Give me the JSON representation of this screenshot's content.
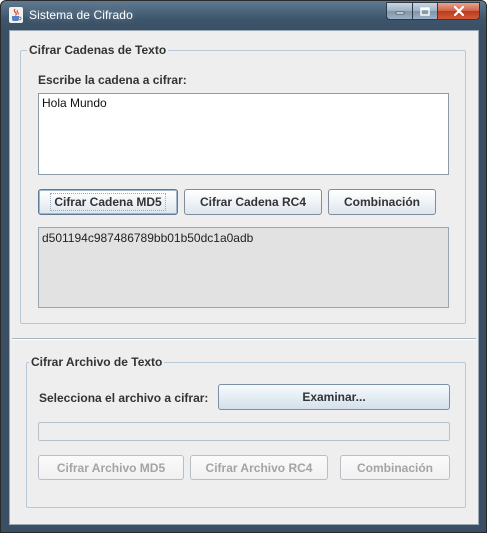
{
  "window": {
    "title": "Sistema de Cifrado",
    "icon": "java-cup-icon",
    "controls": [
      "minimize-icon",
      "maximize-icon",
      "close-icon"
    ]
  },
  "strings_section": {
    "legend": "Cifrar Cadenas de Texto",
    "input_label": "Escribe la cadena a cifrar:",
    "input_value": "Hola Mundo",
    "buttons": {
      "md5": "Cifrar Cadena MD5",
      "rc4": "Cifrar Cadena RC4",
      "combo": "Combinación"
    },
    "output_value": "d501194c987486789bb01b50dc1a0adb"
  },
  "file_section": {
    "legend": "Cifrar Archivo de Texto",
    "select_label": "Selecciona el archivo a cifrar:",
    "browse_label": "Examinar...",
    "progress": 0,
    "buttons": {
      "md5": "Cifrar Archivo MD5",
      "rc4": "Cifrar Archivo RC4",
      "combo": "Combinación"
    }
  },
  "colors": {
    "titlebar": "#3d556b",
    "client_bg": "#eeeeee",
    "group_border": "#b9c8d6",
    "disabled_text": "#a4a4a4"
  }
}
